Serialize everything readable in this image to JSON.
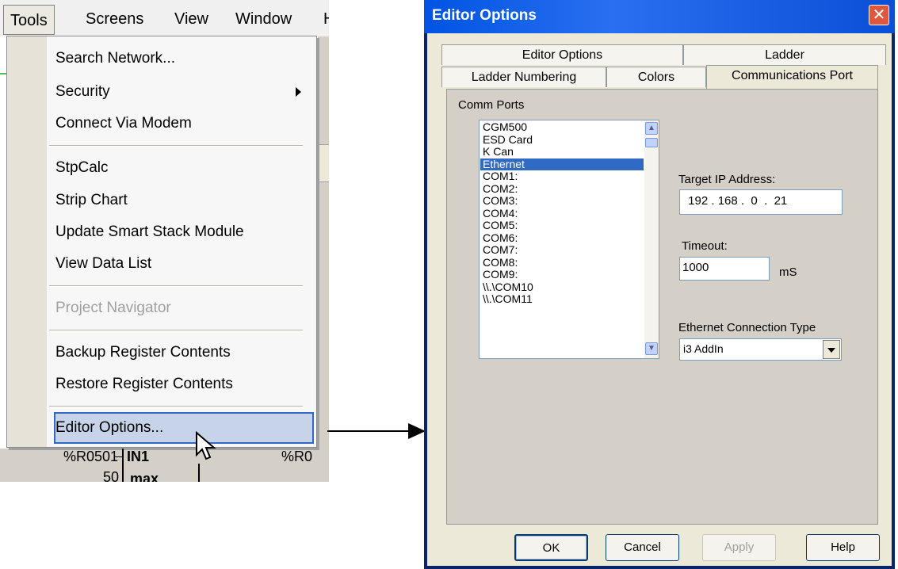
{
  "menu_screenshot": {
    "menubar": [
      "Tools",
      "Screens",
      "View",
      "Window",
      "H"
    ],
    "dropdown_items": [
      {
        "label": "Search Network...",
        "enabled": true
      },
      {
        "label": "Security",
        "enabled": true,
        "submenu": true
      },
      {
        "label": "Connect Via Modem",
        "enabled": true
      },
      {
        "label": "StpCalc",
        "enabled": true
      },
      {
        "label": "Strip Chart",
        "enabled": true
      },
      {
        "label": "Update Smart Stack Module",
        "enabled": true
      },
      {
        "label": "View Data List",
        "enabled": true
      },
      {
        "label": "Project Navigator",
        "enabled": false
      },
      {
        "label": "Backup Register Contents",
        "enabled": true
      },
      {
        "label": "Restore Register Contents",
        "enabled": true
      },
      {
        "label": "Editor Options...",
        "enabled": true,
        "highlighted": true
      }
    ],
    "ladder_fragment": {
      "register_left": "%R0501",
      "register_right": "%R0",
      "block_label": "IN1",
      "value": "50",
      "block_param": "max"
    }
  },
  "dialog": {
    "title": "Editor Options",
    "tabs_back_row": [
      "Editor Options",
      "Ladder"
    ],
    "tabs_front_row": [
      "Ladder Numbering",
      "Colors",
      "Communications Port"
    ],
    "active_tab": "Communications Port",
    "comm_ports_label": "Comm Ports",
    "comm_ports": [
      "CGM500",
      "ESD Card",
      "K Can",
      "Ethernet",
      "COM1:",
      "COM2:",
      "COM3:",
      "COM4:",
      "COM5:",
      "COM6:",
      "COM7:",
      "COM8:",
      "COM9:",
      "\\\\.\\COM10",
      "\\\\.\\COM11"
    ],
    "selected_port": "Ethernet",
    "target_ip_label": "Target IP Address:",
    "target_ip": " 192 . 168 .  0  .  21",
    "timeout_label": "Timeout:",
    "timeout_value": "1000",
    "timeout_unit": "mS",
    "connection_type_label": "Ethernet Connection Type",
    "connection_type_value": "i3 AddIn",
    "buttons": {
      "ok": "OK",
      "cancel": "Cancel",
      "apply": "Apply",
      "help": "Help"
    }
  }
}
